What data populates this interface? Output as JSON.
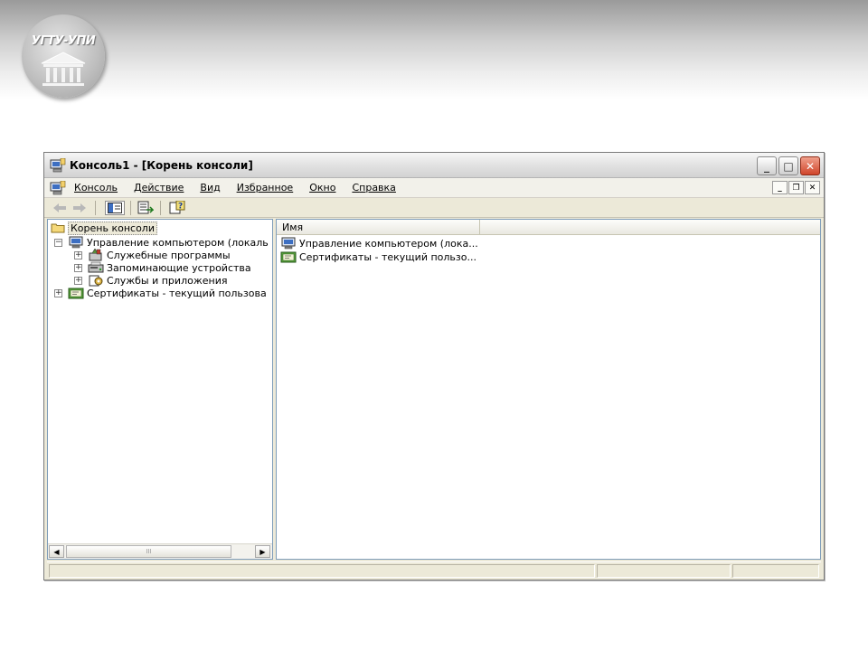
{
  "logo": {
    "text": "УГТУ-УПИ"
  },
  "window": {
    "title": "Консоль1 - [Корень консоли]",
    "title_buttons": [
      "minimize",
      "maximize",
      "close"
    ],
    "menu": [
      "Консоль",
      "Действие",
      "Вид",
      "Избранное",
      "Окно",
      "Справка"
    ],
    "toolbar_icons": [
      "back-arrow-icon",
      "forward-arrow-icon",
      "show-hide-tree-icon",
      "export-list-icon",
      "help-icon"
    ]
  },
  "tree": {
    "root": "Корень консоли",
    "items": [
      {
        "label": "Управление компьютером (локаль",
        "expander": "−",
        "icon": "computer-icon"
      },
      {
        "label": "Служебные программы",
        "expander": "+",
        "icon": "tools-icon"
      },
      {
        "label": "Запоминающие устройства",
        "expander": "+",
        "icon": "storage-icon"
      },
      {
        "label": "Службы и приложения",
        "expander": "+",
        "icon": "services-icon"
      },
      {
        "label": "Сертификаты - текущий пользова",
        "expander": "+",
        "icon": "certificate-icon"
      }
    ],
    "scroll_thumb_mark": "III"
  },
  "list": {
    "column": "Имя",
    "rows": [
      {
        "label": "Управление компьютером (лока...",
        "icon": "computer-icon"
      },
      {
        "label": "Сертификаты - текущий пользо...",
        "icon": "certificate-icon"
      }
    ]
  }
}
